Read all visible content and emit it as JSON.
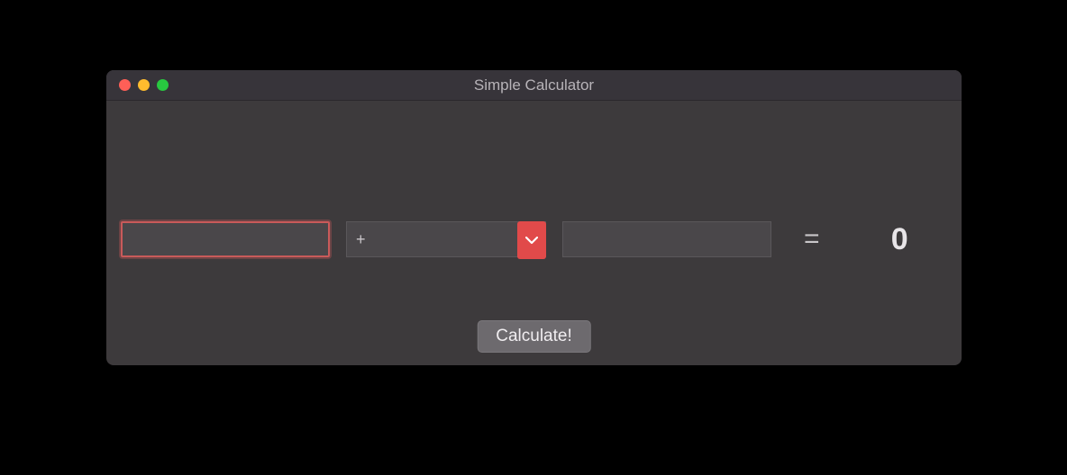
{
  "window": {
    "title": "Simple Calculator"
  },
  "calculator": {
    "operand1": "",
    "operand2": "",
    "operator": "+",
    "equals": "=",
    "result": "0",
    "calculate_label": "Calculate!"
  }
}
